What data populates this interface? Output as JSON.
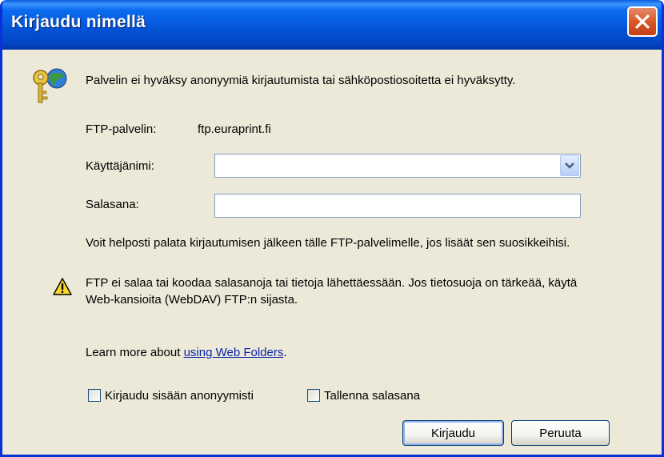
{
  "window": {
    "title": "Kirjaudu nimellä"
  },
  "message": "Palvelin ei hyväksy anonyymiä kirjautumista tai sähköpostiosoitetta ei hyväksytty.",
  "server": {
    "label": "FTP-palvelin:",
    "value": "ftp.euraprint.fi"
  },
  "username": {
    "label": "Käyttäjänimi:",
    "value": ""
  },
  "password": {
    "label": "Salasana:",
    "value": ""
  },
  "info": {
    "favorites_text": "Voit helposti palata kirjautumisen jälkeen tälle FTP-palvelimelle, jos lisäät sen suosikkeihisi.",
    "warning_text": "FTP ei salaa tai koodaa salasanoja tai tietoja lähettäessään. Jos tietosuoja on tärkeää, käytä Web-kansioita (WebDAV) FTP:n sijasta.",
    "learn_more_prefix": "Learn more about ",
    "learn_more_link": "using Web Folders",
    "learn_more_suffix": "."
  },
  "options": {
    "anonymous_label": "Kirjaudu sisään anonyymisti",
    "anonymous_checked": false,
    "save_password_label": "Tallenna salasana",
    "save_password_checked": false
  },
  "buttons": {
    "login": "Kirjaudu",
    "cancel": "Peruuta"
  },
  "colors": {
    "titlebar": "#0b6cef",
    "dialog_bg": "#ece9d8",
    "link": "#0b24a8",
    "close": "#d8541f"
  },
  "icons": {
    "header": "keys-globe-icon",
    "warning": "warning-icon",
    "close": "close-icon",
    "dropdown": "chevron-down-icon"
  }
}
